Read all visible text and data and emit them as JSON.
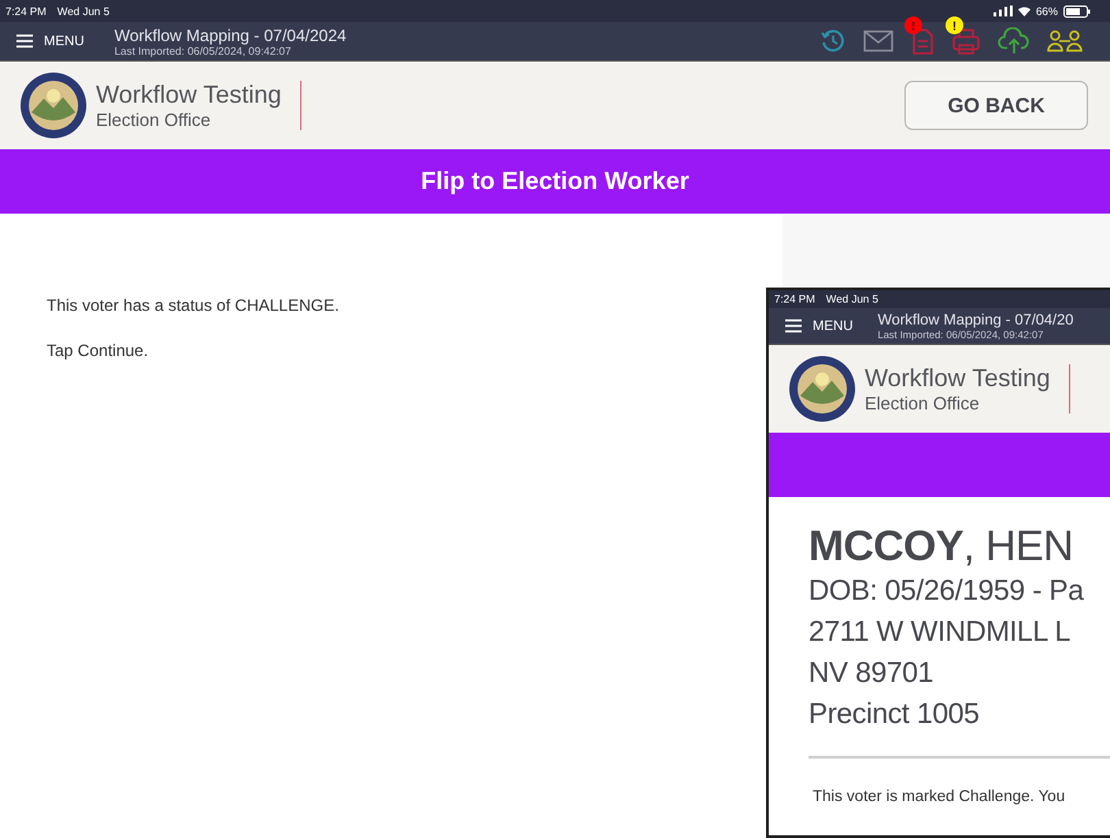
{
  "main": {
    "status_bar": {
      "time": "7:24 PM",
      "date": "Wed Jun 5",
      "battery": "66%"
    },
    "app_bar": {
      "menu": "MENU",
      "title": "Workflow Mapping - 07/04/2024",
      "subtitle": "Last Imported: 06/05/2024, 09:42:07",
      "toolbar": [
        {
          "kind": "history"
        },
        {
          "kind": "mail"
        },
        {
          "kind": "document",
          "badge": "!",
          "color": "#ff0000"
        },
        {
          "kind": "printer",
          "badge": "!",
          "color": "#ffee00"
        },
        {
          "kind": "upload"
        },
        {
          "kind": "people"
        }
      ]
    },
    "header": {
      "org": "Workflow Testing",
      "office": "Election Office",
      "back_button": "GO BACK"
    },
    "banner": {
      "title": "Flip to Election Worker"
    },
    "messages": [
      "This voter has a status of CHALLENGE.",
      "Tap Continue."
    ]
  },
  "inset": {
    "status_bar": {
      "time": "7:24 PM",
      "date": "Wed Jun 5"
    },
    "app_bar": {
      "menu": "MENU",
      "title": "Workflow Mapping - 07/04/20",
      "subtitle": "Last Imported: 06/05/2024, 09:42:07"
    },
    "header": {
      "org": "Workflow Testing",
      "office": "Election Office"
    },
    "voter": {
      "name": "**MCCOY**, HEN",
      "details": [
        "DOB: 05/26/1959 - Pa",
        "2711 W WINDMILL L",
        "NV 89701",
        "Precinct 1005"
      ]
    },
    "notice": "This voter is marked Challenge. You"
  }
}
